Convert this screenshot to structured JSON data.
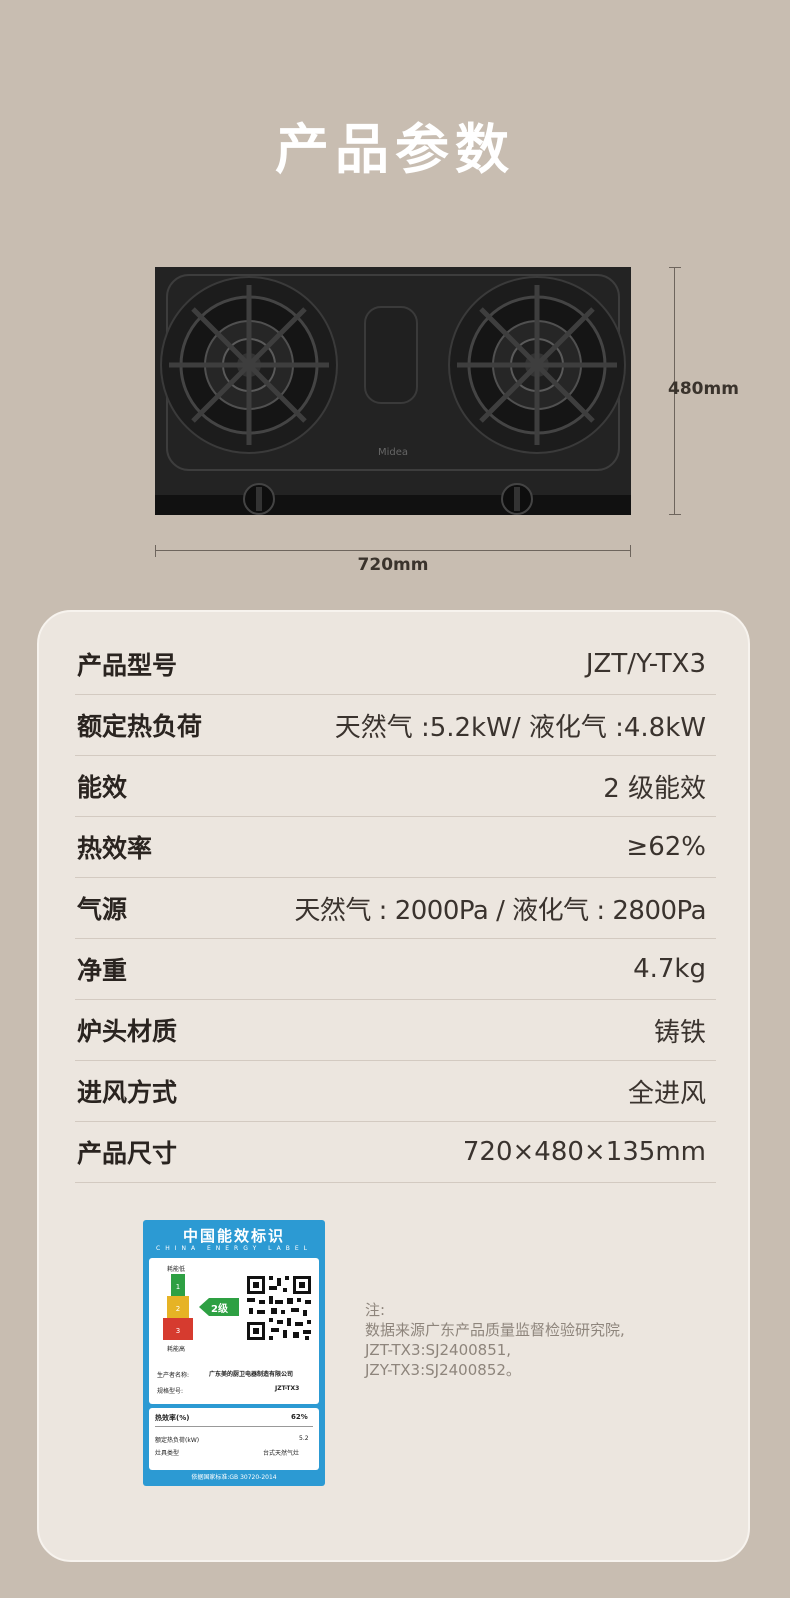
{
  "page_title": "产品参数",
  "product_image": {
    "brand_mark": "Midea",
    "height_label": "480mm",
    "width_label": "720mm"
  },
  "specs": [
    {
      "label": "产品型号",
      "value": "JZT/Y-TX3"
    },
    {
      "label": "额定热负荷",
      "value": "天然气 :5.2kW/ 液化气 :4.8kW"
    },
    {
      "label": "能效",
      "value": "2 级能效"
    },
    {
      "label": "热效率",
      "value": "≥62%"
    },
    {
      "label": "气源",
      "value": "天然气 : 2000Pa / 液化气 : 2800Pa"
    },
    {
      "label": "净重",
      "value": "4.7kg"
    },
    {
      "label": "炉头材质",
      "value": "铸铁"
    },
    {
      "label": "进风方式",
      "value": "全进风"
    },
    {
      "label": "产品尺寸",
      "value": "720×480×135mm"
    }
  ],
  "energy_label": {
    "title": "中国能效标识",
    "subtitle": "CHINA ENERGY LABEL",
    "low_consumption": "耗能低",
    "high_consumption": "耗能高",
    "grades": [
      "1",
      "2",
      "3"
    ],
    "grade_badge": "2级",
    "manufacturer_label": "生产者名称:",
    "manufacturer": "广东美的厨卫电器制造有限公司",
    "model_label": "规格型号:",
    "model": "JZT-TX3",
    "efficiency_label": "热效率(%)",
    "efficiency": "62%",
    "heat_load_label": "额定热负荷(kW)",
    "heat_load": "5.2",
    "type_label": "灶具类型",
    "type": "台式天然气灶",
    "standard": "依据国家标准:GB 30720-2014"
  },
  "note": {
    "heading": "注:",
    "line1": "数据来源广东产品质量监督检验研究院,",
    "line2": "JZT-TX3:SJ2400851,",
    "line3": "JZY-TX3:SJ2400852。"
  },
  "colors": {
    "background": "#c8bdb1",
    "card": "#ece6df",
    "label_blue": "#2c9ad3",
    "grade_green": "#2ea043",
    "grade_yellow": "#e6b325",
    "grade_red": "#d63b2f"
  }
}
